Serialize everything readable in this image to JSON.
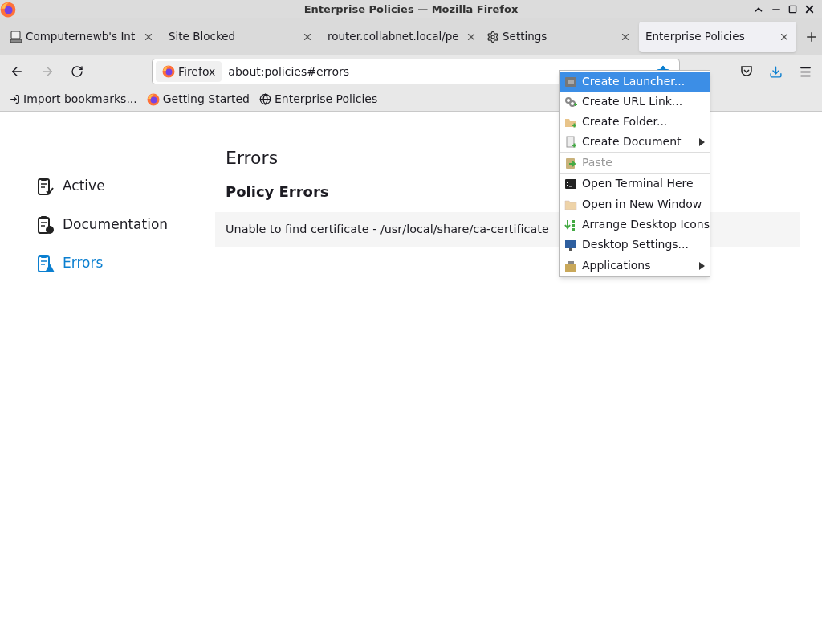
{
  "window": {
    "title": "Enterprise Policies — Mozilla Firefox"
  },
  "tabs": [
    {
      "label": "Computernewb's Int",
      "selected": false
    },
    {
      "label": "Site Blocked",
      "selected": false
    },
    {
      "label": "router.collabnet.local/pe",
      "selected": false
    },
    {
      "label": "Settings",
      "selected": false
    },
    {
      "label": "Enterprise Policies",
      "selected": true
    }
  ],
  "url_bar": {
    "identity": "Firefox",
    "value": "about:policies#errors"
  },
  "bookmarks": [
    "Import bookmarks...",
    "Getting Started",
    "Enterprise Policies"
  ],
  "sidebar": {
    "items": [
      {
        "label": "Active",
        "selected": false
      },
      {
        "label": "Documentation",
        "selected": false
      },
      {
        "label": "Errors",
        "selected": true
      }
    ]
  },
  "content": {
    "title": "Errors",
    "heading": "Policy Errors",
    "errors": [
      "Unable to find certificate - /usr/local/share/ca-certificate"
    ]
  },
  "context_menu": {
    "groups": [
      [
        {
          "label": "Create Launcher...",
          "selected": true,
          "disabled": false,
          "submenu": false
        },
        {
          "label": "Create URL Link...",
          "selected": false,
          "disabled": false,
          "submenu": false
        },
        {
          "label": "Create Folder...",
          "selected": false,
          "disabled": false,
          "submenu": false
        },
        {
          "label": "Create Document",
          "selected": false,
          "disabled": false,
          "submenu": true
        }
      ],
      [
        {
          "label": "Paste",
          "selected": false,
          "disabled": true,
          "submenu": false
        }
      ],
      [
        {
          "label": "Open Terminal Here",
          "selected": false,
          "disabled": false,
          "submenu": false
        }
      ],
      [
        {
          "label": "Open in New Window",
          "selected": false,
          "disabled": false,
          "submenu": false
        },
        {
          "label": "Arrange Desktop Icons",
          "selected": false,
          "disabled": false,
          "submenu": false
        },
        {
          "label": "Desktop Settings...",
          "selected": false,
          "disabled": false,
          "submenu": false
        }
      ],
      [
        {
          "label": "Applications",
          "selected": false,
          "disabled": false,
          "submenu": true
        }
      ]
    ]
  }
}
